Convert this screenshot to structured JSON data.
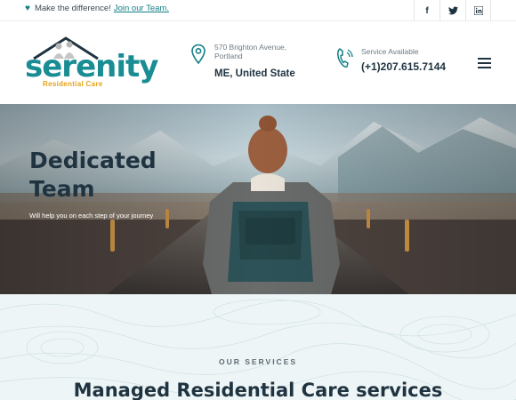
{
  "topbar": {
    "message": "Make the difference!",
    "link": "Join our Team.",
    "socials": [
      {
        "icon": "facebook-icon",
        "glyph": "f"
      },
      {
        "icon": "twitter-icon",
        "glyph": "t"
      },
      {
        "icon": "linkedin-icon",
        "glyph": "in"
      }
    ]
  },
  "header": {
    "logo": {
      "word": "serenity",
      "sub": "Residential Care"
    },
    "address": {
      "line1": "570 Brighton Avenue, Portland",
      "line2": "ME, United State"
    },
    "phone": {
      "label": "Service Available",
      "number": "(+1)207.615.7144"
    }
  },
  "hero": {
    "title_line1": "Dedicated",
    "title_line2": "Team",
    "tagline": "Will help you on each step of your journey"
  },
  "services": {
    "kicker": "OUR SERVICES",
    "title": "Managed Residential Care services"
  },
  "colors": {
    "accent": "#127f86",
    "brand_gold": "#e3a31d",
    "dark": "#1f3340"
  }
}
